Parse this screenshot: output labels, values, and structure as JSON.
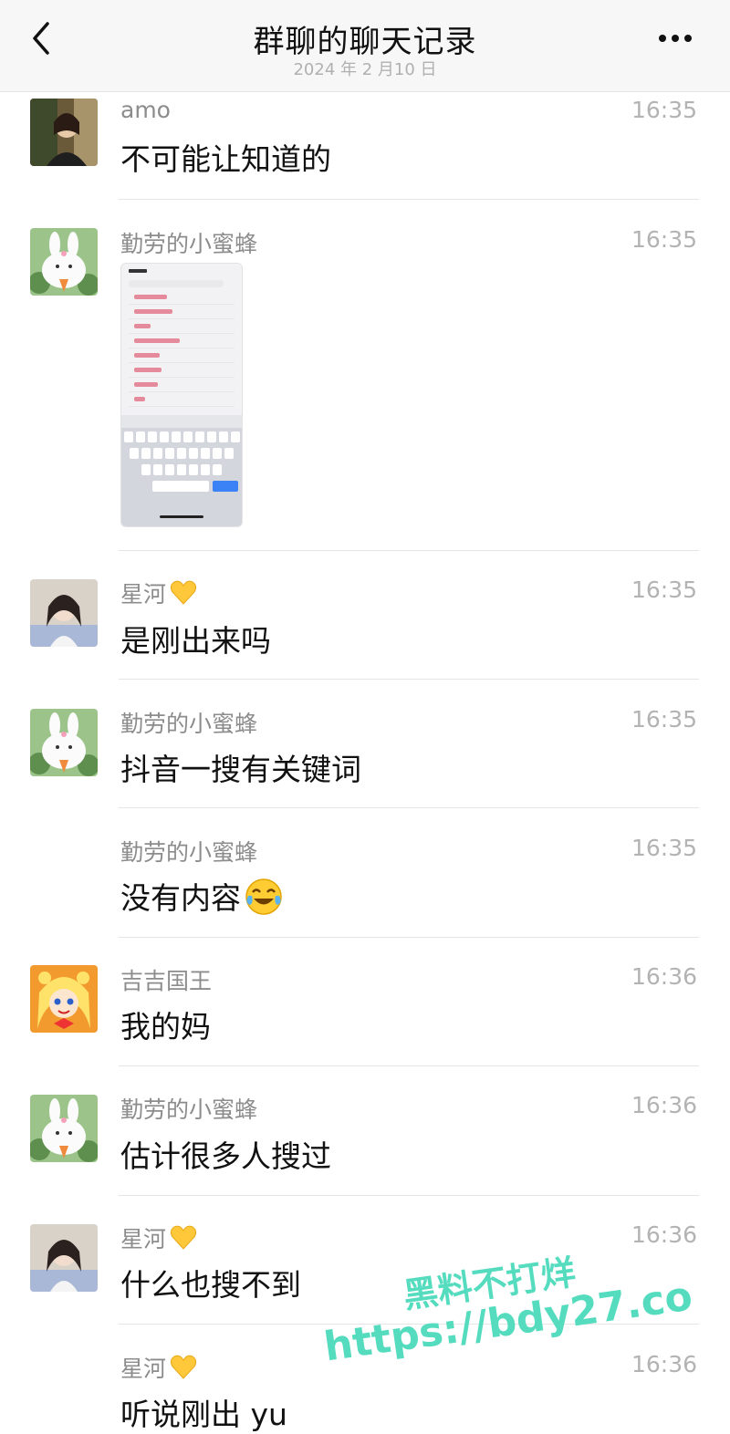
{
  "header": {
    "title": "群聊的聊天记录",
    "date": "2024 年 2 月10 日"
  },
  "messages": [
    {
      "sender": "amo",
      "time": "16:35",
      "text": "不可能让知道的",
      "avatar": "woman-photo"
    },
    {
      "sender": "勤劳的小蜜蜂",
      "time": "16:35",
      "text": "",
      "avatar": "bunny-cartoon",
      "attachment": "search-screenshot"
    },
    {
      "sender": "星河",
      "time": "16:35",
      "text": "是刚出来吗",
      "avatar": "girl-photo",
      "sender_emoji": "yellow-heart"
    },
    {
      "sender": "勤劳的小蜜蜂",
      "time": "16:35",
      "text": "抖音一搜有关键词",
      "avatar": "bunny-cartoon"
    },
    {
      "sender": "勤劳的小蜜蜂",
      "time": "16:35",
      "text": "没有内容",
      "avatar": "",
      "text_emoji": "laughing-crying"
    },
    {
      "sender": "吉吉国王",
      "time": "16:36",
      "text": "我的妈",
      "avatar": "anime-girl"
    },
    {
      "sender": "勤劳的小蜜蜂",
      "time": "16:36",
      "text": "估计很多人搜过",
      "avatar": "bunny-cartoon"
    },
    {
      "sender": "星河",
      "time": "16:36",
      "text": "什么也搜不到",
      "avatar": "girl-photo",
      "sender_emoji": "yellow-heart"
    },
    {
      "sender": "星河",
      "time": "16:36",
      "text": "听说刚出 yu",
      "avatar": "",
      "sender_emoji": "yellow-heart"
    }
  ],
  "watermark": {
    "line1": "黑料不打烊",
    "line2": "https://bdy27.co"
  },
  "colors": {
    "watermark": "#55dcbf",
    "divider": "#e5e5e5",
    "meta": "#8c8c8c"
  }
}
